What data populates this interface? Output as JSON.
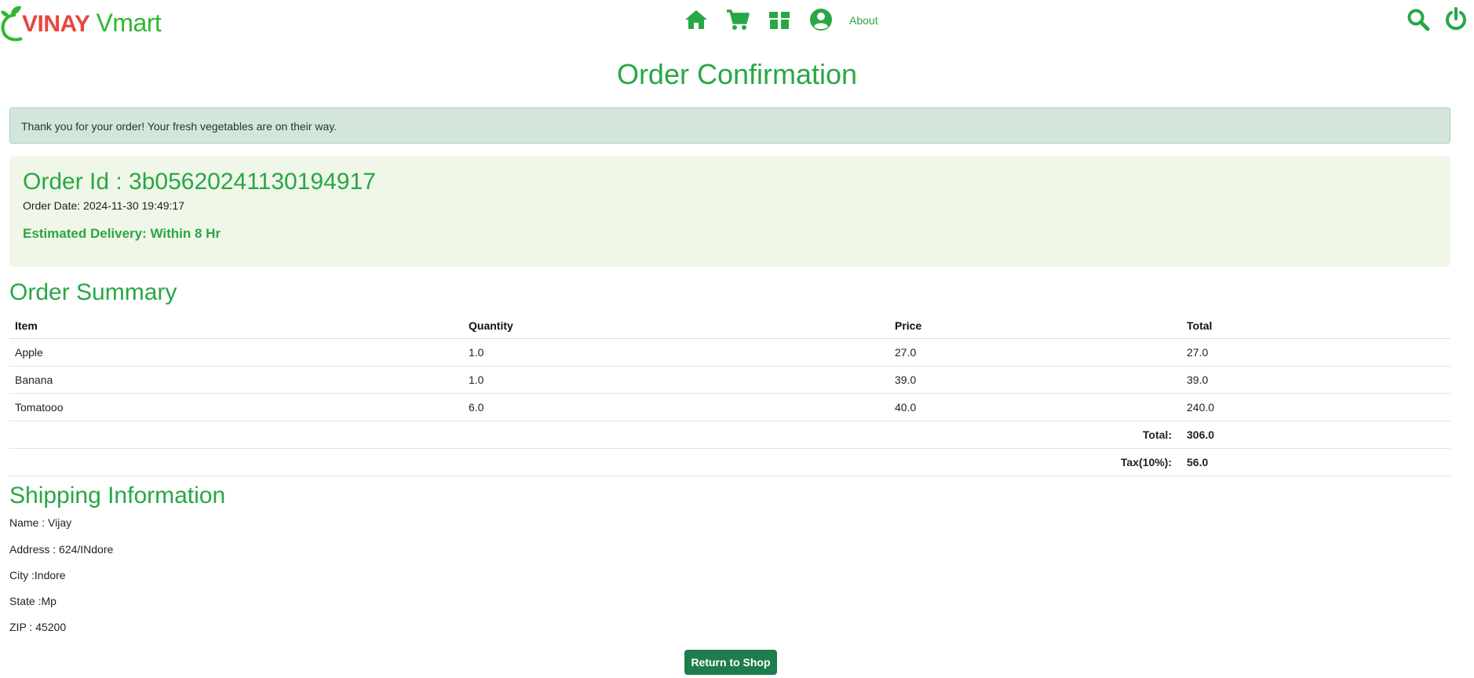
{
  "header": {
    "brand_part1": "VINAY",
    "brand_part2": "Vmart",
    "nav": {
      "icons": [
        "home-icon",
        "cart-icon",
        "box-icon",
        "user-icon"
      ],
      "about_label": "About"
    },
    "right_icons": [
      "search-icon",
      "power-icon"
    ]
  },
  "page": {
    "title": "Order Confirmation",
    "alert_text": "Thank you for your order! Your fresh vegetables are on their way."
  },
  "order": {
    "id_text": "Order Id : 3b05620241130194917",
    "date_text": "Order Date: 2024-11-30 19:49:17",
    "delivery_text": "Estimated Delivery: Within 8 Hr"
  },
  "summary": {
    "title": "Order Summary",
    "columns": [
      "Item",
      "Quantity",
      "Price",
      "Total"
    ],
    "rows": [
      {
        "item": "Apple",
        "quantity": "1.0",
        "price": "27.0",
        "total": "27.0"
      },
      {
        "item": "Banana",
        "quantity": "1.0",
        "price": "39.0",
        "total": "39.0"
      },
      {
        "item": "Tomatooo",
        "quantity": "6.0",
        "price": "40.0",
        "total": "240.0"
      }
    ],
    "total_label": "Total:",
    "total_value": "306.0",
    "tax_label": "Tax(10%):",
    "tax_value": "56.0"
  },
  "shipping": {
    "title": "Shipping Information",
    "name": "Name : Vijay",
    "address": "Address : 624/INdore",
    "city": "City :Indore",
    "state": "State :Mp",
    "zip": "ZIP : 45200"
  },
  "actions": {
    "return_label": "Return to Shop"
  },
  "colors": {
    "accent": "#28a745",
    "logo_red": "#e8453c",
    "logo_green": "#2eb82e",
    "alert_bg": "#d4e6dc",
    "order_box_bg": "#f0f6e8",
    "button_bg": "#1e7d4c"
  }
}
